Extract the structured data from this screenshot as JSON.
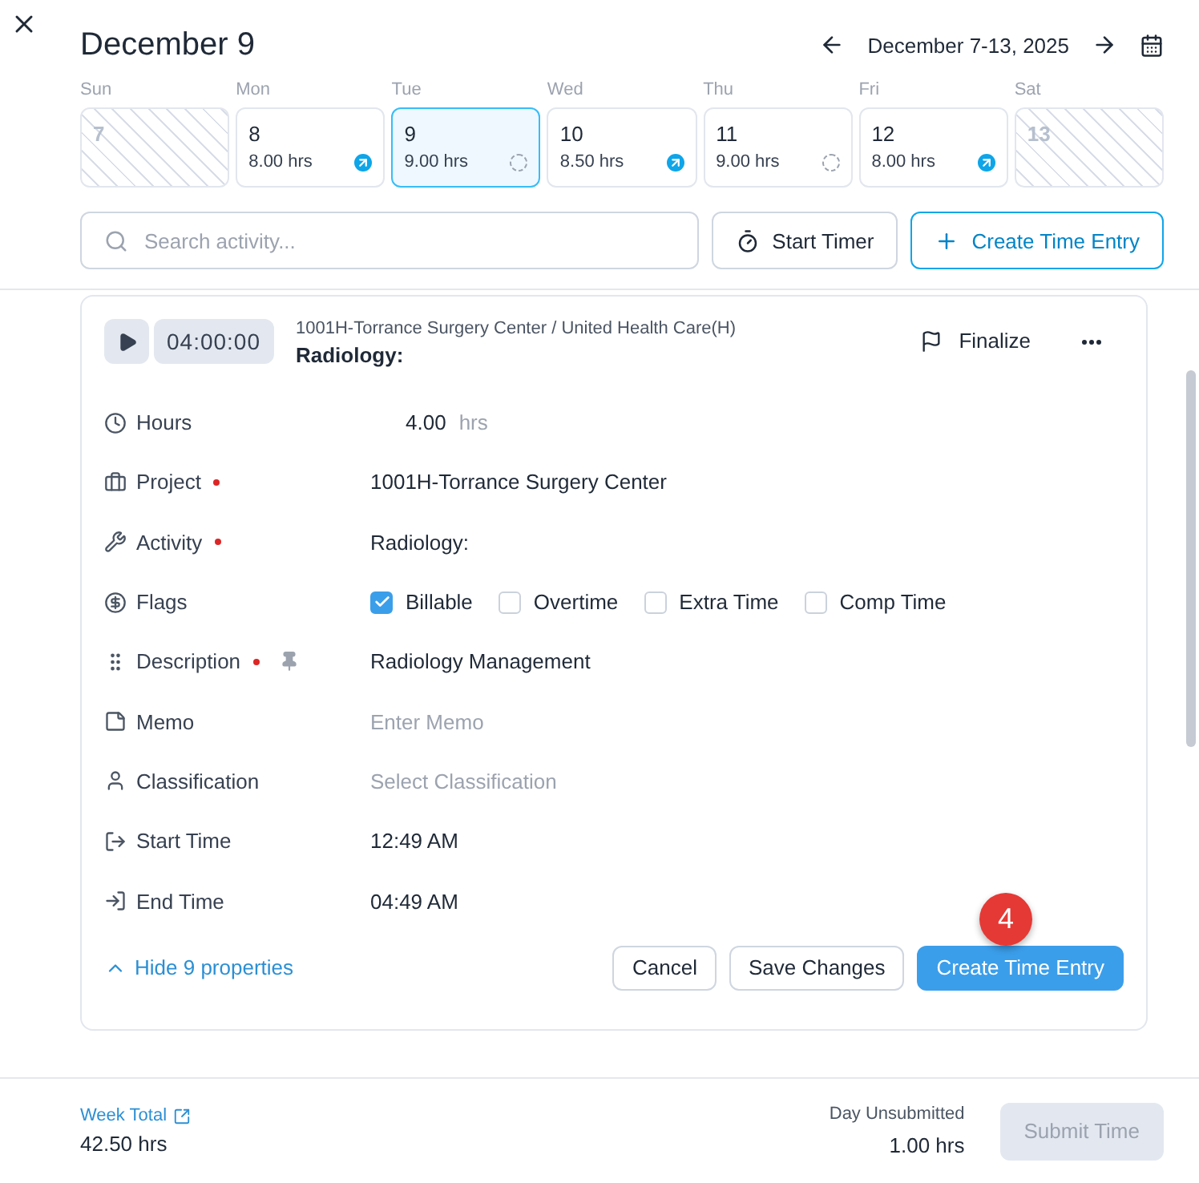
{
  "header": {
    "title": "December 9",
    "week_range": "December 7-13, 2025"
  },
  "days": [
    {
      "weekday": "Sun",
      "date": "7",
      "kind": "weekend",
      "selected": false
    },
    {
      "weekday": "Mon",
      "date": "8",
      "hours": "8.00 hrs",
      "kind": "submitted",
      "selected": false
    },
    {
      "weekday": "Tue",
      "date": "9",
      "hours": "9.00 hrs",
      "kind": "pending",
      "selected": true
    },
    {
      "weekday": "Wed",
      "date": "10",
      "hours": "8.50 hrs",
      "kind": "submitted",
      "selected": false
    },
    {
      "weekday": "Thu",
      "date": "11",
      "hours": "9.00 hrs",
      "kind": "pending",
      "selected": false
    },
    {
      "weekday": "Fri",
      "date": "12",
      "hours": "8.00 hrs",
      "kind": "submitted",
      "selected": false
    },
    {
      "weekday": "Sat",
      "date": "13",
      "kind": "weekend",
      "selected": false
    }
  ],
  "search": {
    "placeholder": "Search activity..."
  },
  "toolbar_buttons": [
    {
      "label": "Start Timer",
      "kind": "timer"
    },
    {
      "label": "Create Time Entry",
      "kind": "create"
    }
  ],
  "entry": {
    "timer": "04:00:00",
    "path": "1001H-Torrance Surgery Center / United Health Care(H)",
    "activity": "Radiology:",
    "finalize": "Finalize",
    "fields": [
      {
        "label": "Hours",
        "kind": "hours",
        "value": "4.00",
        "unit": "hrs",
        "required": false
      },
      {
        "label": "Project",
        "kind": "text",
        "value": "1001H-Torrance Surgery Center",
        "required": true
      },
      {
        "label": "Activity",
        "kind": "text",
        "value": "Radiology:",
        "required": true
      },
      {
        "label": "Flags",
        "kind": "checks",
        "required": false,
        "options": [
          {
            "label": "Billable",
            "checked": true
          },
          {
            "label": "Overtime",
            "checked": false
          },
          {
            "label": "Extra Time",
            "checked": false
          },
          {
            "label": "Comp Time",
            "checked": false
          }
        ]
      },
      {
        "label": "Description",
        "kind": "text",
        "value": "Radiology Management",
        "required": true,
        "pinned": true
      },
      {
        "label": "Memo",
        "kind": "placeholder",
        "placeholder": "Enter Memo",
        "required": false
      },
      {
        "label": "Classification",
        "kind": "placeholder",
        "placeholder": "Select Classification",
        "required": false
      },
      {
        "label": "Start Time",
        "kind": "text",
        "value": "12:49 AM",
        "required": false
      },
      {
        "label": "End Time",
        "kind": "text",
        "value": "04:49 AM",
        "required": false
      }
    ],
    "hide_link": "Hide 9 properties",
    "actions": [
      {
        "label": "Cancel",
        "kind": "secondary"
      },
      {
        "label": "Save Changes",
        "kind": "secondary"
      },
      {
        "label": "Create Time Entry",
        "kind": "primary"
      }
    ],
    "step_badge": "4"
  },
  "footer": {
    "week_total_label": "Week Total",
    "week_total": "42.50 hrs",
    "day_label": "Day Unsubmitted",
    "day_value": "1.00 hrs",
    "submit": "Submit Time",
    "submit_disabled": true
  }
}
